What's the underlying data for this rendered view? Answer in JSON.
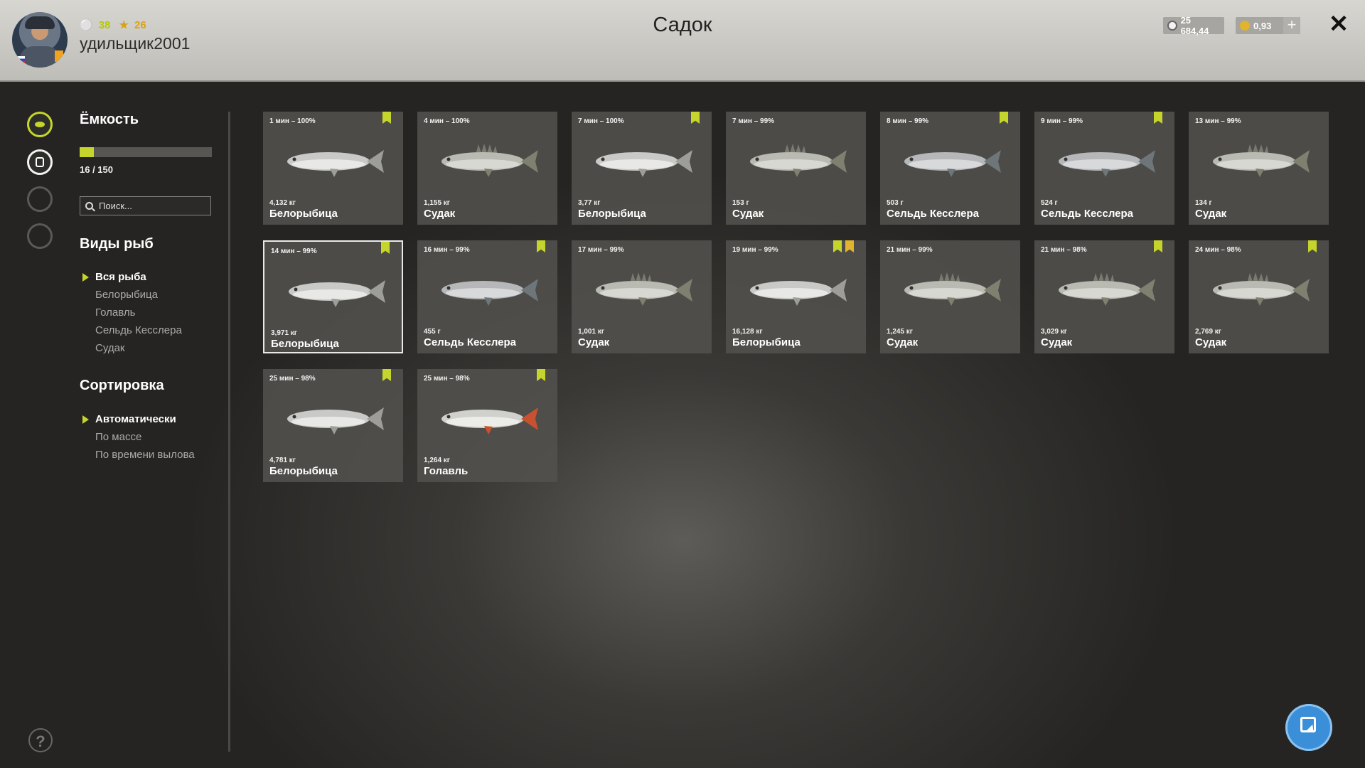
{
  "header": {
    "title": "Садок",
    "username": "удильщик2001",
    "level": "38",
    "stars": "26",
    "money": "25 684,44",
    "gold": "0,93",
    "plus": "+",
    "close": "✕"
  },
  "sidebar": {
    "capacity_title": "Ёмкость",
    "capacity_current": 16,
    "capacity_max": 150,
    "capacity_text": "16 / 150",
    "search_placeholder": "Поиск...",
    "species_title": "Виды рыб",
    "species": [
      "Вся рыба",
      "Белорыбица",
      "Голавль",
      "Сельдь Кесслера",
      "Судак"
    ],
    "sort_title": "Сортировка",
    "sort": [
      "Автоматически",
      "По массе",
      "По времени вылова"
    ],
    "help": "?"
  },
  "colors": {
    "accent": "#c6d52b",
    "gold": "#e2b32c",
    "card_bg": "#52514d"
  },
  "fish": [
    {
      "time": "1 мин – 100%",
      "weight": "4,132 кг",
      "name": "Белорыбица",
      "kind": "whitefish",
      "badges": [
        "green"
      ]
    },
    {
      "time": "4 мин – 100%",
      "weight": "1,155 кг",
      "name": "Судак",
      "kind": "zander",
      "badges": []
    },
    {
      "time": "7 мин – 100%",
      "weight": "3,77 кг",
      "name": "Белорыбица",
      "kind": "whitefish",
      "badges": [
        "green"
      ]
    },
    {
      "time": "7 мин – 99%",
      "weight": "153 г",
      "name": "Судак",
      "kind": "zander",
      "badges": []
    },
    {
      "time": "8 мин – 99%",
      "weight": "503 г",
      "name": "Сельдь Кесслера",
      "kind": "herring",
      "badges": [
        "green"
      ]
    },
    {
      "time": "9 мин – 99%",
      "weight": "524 г",
      "name": "Сельдь Кесслера",
      "kind": "herring",
      "badges": [
        "green"
      ]
    },
    {
      "time": "13 мин – 99%",
      "weight": "134 г",
      "name": "Судак",
      "kind": "zander",
      "badges": []
    },
    {
      "time": "14 мин – 99%",
      "weight": "3,971 кг",
      "name": "Белорыбица",
      "kind": "whitefish",
      "badges": [
        "green"
      ],
      "selected": true
    },
    {
      "time": "16 мин – 99%",
      "weight": "455 г",
      "name": "Сельдь Кесслера",
      "kind": "herring",
      "badges": [
        "green"
      ]
    },
    {
      "time": "17 мин – 99%",
      "weight": "1,001 кг",
      "name": "Судак",
      "kind": "zander",
      "badges": []
    },
    {
      "time": "19 мин – 99%",
      "weight": "16,128 кг",
      "name": "Белорыбица",
      "kind": "whitefish",
      "badges": [
        "green",
        "gold"
      ]
    },
    {
      "time": "21 мин – 99%",
      "weight": "1,245 кг",
      "name": "Судак",
      "kind": "zander",
      "badges": []
    },
    {
      "time": "21 мин – 98%",
      "weight": "3,029 кг",
      "name": "Судак",
      "kind": "zander",
      "badges": [
        "green"
      ]
    },
    {
      "time": "24 мин – 98%",
      "weight": "2,769 кг",
      "name": "Судак",
      "kind": "zander",
      "badges": [
        "green"
      ]
    },
    {
      "time": "25 мин – 98%",
      "weight": "4,781 кг",
      "name": "Белорыбица",
      "kind": "whitefish",
      "badges": [
        "green"
      ]
    },
    {
      "time": "25 мин – 98%",
      "weight": "1,264 кг",
      "name": "Голавль",
      "kind": "chub",
      "badges": [
        "green"
      ]
    }
  ]
}
